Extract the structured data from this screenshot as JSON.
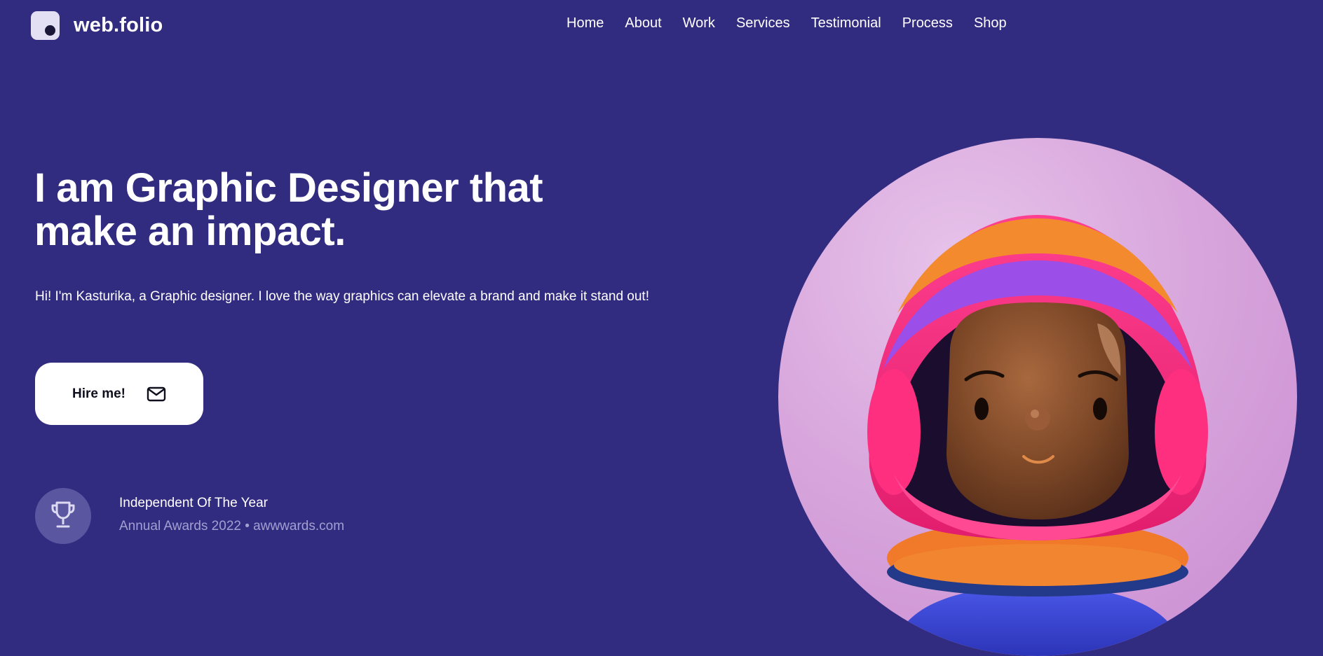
{
  "brand": {
    "name": "web.folio"
  },
  "nav": {
    "items": [
      "Home",
      "About",
      "Work",
      "Services",
      "Testimonial",
      "Process",
      "Shop"
    ]
  },
  "hero": {
    "title_line1": "I am Graphic Designer that",
    "title_line2": "make an impact.",
    "intro": "Hi! I'm Kasturika, a Graphic designer. I love the way graphics can elevate a brand and make it stand out!",
    "cta_label": "Hire me!",
    "cta_icon": "mail-icon"
  },
  "award": {
    "icon": "trophy-icon",
    "title": "Independent Of The Year",
    "subtitle": "Annual Awards 2022 • awwwards.com"
  },
  "colors": {
    "background": "#322c80",
    "text": "#ffffff",
    "muted": "#a39fd2",
    "button_bg": "#ffffff",
    "badge_bg": "#5a56a0"
  }
}
